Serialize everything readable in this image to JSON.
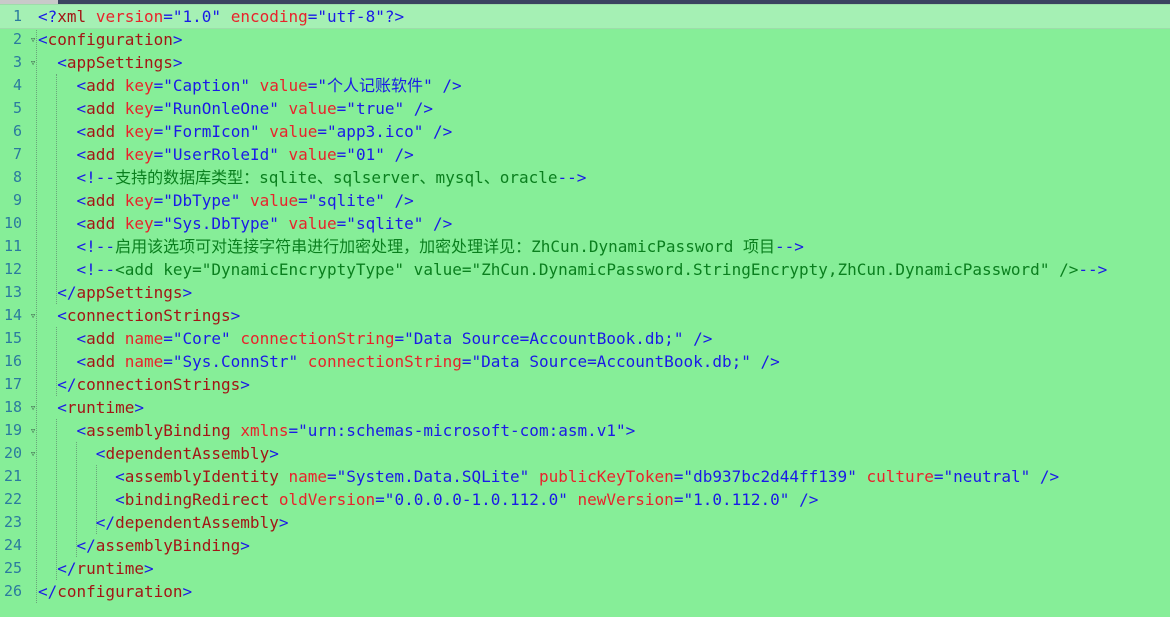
{
  "editor": {
    "language": "xml",
    "current_line": 1,
    "colors": {
      "background": "#86ee98",
      "line_number": "#2b7a9e",
      "delimiter": "#1a1ae6",
      "element": "#a31515",
      "attribute": "#e8232b",
      "attribute_value": "#1a1ae6",
      "comment": "#0a7f1e"
    },
    "lines": [
      {
        "n": "1",
        "tokens": [
          [
            "bl",
            "<?"
          ],
          [
            "br",
            "xml"
          ],
          [
            "tx",
            " "
          ],
          [
            "rd",
            "version"
          ],
          [
            "bl",
            "=\""
          ],
          [
            "vl",
            "1.0"
          ],
          [
            "bl",
            "\""
          ],
          [
            "tx",
            " "
          ],
          [
            "rd",
            "encoding"
          ],
          [
            "bl",
            "=\""
          ],
          [
            "vl",
            "utf-8"
          ],
          [
            "bl",
            "\"?>"
          ]
        ]
      },
      {
        "n": "2",
        "tokens": [
          [
            "bl",
            "<"
          ],
          [
            "br",
            "configuration"
          ],
          [
            "bl",
            ">"
          ]
        ]
      },
      {
        "n": "3",
        "tokens": [
          [
            "tx",
            "  "
          ],
          [
            "bl",
            "<"
          ],
          [
            "br",
            "appSettings"
          ],
          [
            "bl",
            ">"
          ]
        ]
      },
      {
        "n": "4",
        "tokens": [
          [
            "tx",
            "    "
          ],
          [
            "bl",
            "<"
          ],
          [
            "br",
            "add"
          ],
          [
            "tx",
            " "
          ],
          [
            "rd",
            "key"
          ],
          [
            "bl",
            "=\""
          ],
          [
            "vl",
            "Caption"
          ],
          [
            "bl",
            "\""
          ],
          [
            "tx",
            " "
          ],
          [
            "rd",
            "value"
          ],
          [
            "bl",
            "=\""
          ],
          [
            "vl",
            "个人记账软件"
          ],
          [
            "bl",
            "\""
          ],
          [
            "tx",
            " "
          ],
          [
            "bl",
            "/>"
          ]
        ]
      },
      {
        "n": "5",
        "tokens": [
          [
            "tx",
            "    "
          ],
          [
            "bl",
            "<"
          ],
          [
            "br",
            "add"
          ],
          [
            "tx",
            " "
          ],
          [
            "rd",
            "key"
          ],
          [
            "bl",
            "=\""
          ],
          [
            "vl",
            "RunOnleOne"
          ],
          [
            "bl",
            "\""
          ],
          [
            "tx",
            " "
          ],
          [
            "rd",
            "value"
          ],
          [
            "bl",
            "=\""
          ],
          [
            "vl",
            "true"
          ],
          [
            "bl",
            "\""
          ],
          [
            "tx",
            " "
          ],
          [
            "bl",
            "/>"
          ]
        ]
      },
      {
        "n": "6",
        "tokens": [
          [
            "tx",
            "    "
          ],
          [
            "bl",
            "<"
          ],
          [
            "br",
            "add"
          ],
          [
            "tx",
            " "
          ],
          [
            "rd",
            "key"
          ],
          [
            "bl",
            "=\""
          ],
          [
            "vl",
            "FormIcon"
          ],
          [
            "bl",
            "\""
          ],
          [
            "tx",
            " "
          ],
          [
            "rd",
            "value"
          ],
          [
            "bl",
            "=\""
          ],
          [
            "vl",
            "app3.ico"
          ],
          [
            "bl",
            "\""
          ],
          [
            "tx",
            " "
          ],
          [
            "bl",
            "/>"
          ]
        ]
      },
      {
        "n": "7",
        "tokens": [
          [
            "tx",
            "    "
          ],
          [
            "bl",
            "<"
          ],
          [
            "br",
            "add"
          ],
          [
            "tx",
            " "
          ],
          [
            "rd",
            "key"
          ],
          [
            "bl",
            "=\""
          ],
          [
            "vl",
            "UserRoleId"
          ],
          [
            "bl",
            "\""
          ],
          [
            "tx",
            " "
          ],
          [
            "rd",
            "value"
          ],
          [
            "bl",
            "=\""
          ],
          [
            "vl",
            "01"
          ],
          [
            "bl",
            "\""
          ],
          [
            "tx",
            " "
          ],
          [
            "bl",
            "/>"
          ]
        ]
      },
      {
        "n": "8",
        "tokens": [
          [
            "tx",
            "    "
          ],
          [
            "bl",
            "<!--"
          ],
          [
            "cm",
            "支持的数据库类型：sqlite、sqlserver、mysql、oracle"
          ],
          [
            "bl",
            "-->"
          ]
        ]
      },
      {
        "n": "9",
        "tokens": [
          [
            "tx",
            "    "
          ],
          [
            "bl",
            "<"
          ],
          [
            "br",
            "add"
          ],
          [
            "tx",
            " "
          ],
          [
            "rd",
            "key"
          ],
          [
            "bl",
            "=\""
          ],
          [
            "vl",
            "DbType"
          ],
          [
            "bl",
            "\""
          ],
          [
            "tx",
            " "
          ],
          [
            "rd",
            "value"
          ],
          [
            "bl",
            "=\""
          ],
          [
            "vl",
            "sqlite"
          ],
          [
            "bl",
            "\""
          ],
          [
            "tx",
            " "
          ],
          [
            "bl",
            "/>"
          ]
        ]
      },
      {
        "n": "10",
        "tokens": [
          [
            "tx",
            "    "
          ],
          [
            "bl",
            "<"
          ],
          [
            "br",
            "add"
          ],
          [
            "tx",
            " "
          ],
          [
            "rd",
            "key"
          ],
          [
            "bl",
            "=\""
          ],
          [
            "vl",
            "Sys.DbType"
          ],
          [
            "bl",
            "\""
          ],
          [
            "tx",
            " "
          ],
          [
            "rd",
            "value"
          ],
          [
            "bl",
            "=\""
          ],
          [
            "vl",
            "sqlite"
          ],
          [
            "bl",
            "\""
          ],
          [
            "tx",
            " "
          ],
          [
            "bl",
            "/>"
          ]
        ]
      },
      {
        "n": "11",
        "tokens": [
          [
            "tx",
            "    "
          ],
          [
            "bl",
            "<!--"
          ],
          [
            "cm",
            "启用该选项可对连接字符串进行加密处理，加密处理详见：ZhCun.DynamicPassword 项目"
          ],
          [
            "bl",
            "-->"
          ]
        ]
      },
      {
        "n": "12",
        "tokens": [
          [
            "tx",
            "    "
          ],
          [
            "bl",
            "<!--"
          ],
          [
            "cm",
            "<add key=\"DynamicEncryptyType\" value=\"ZhCun.DynamicPassword.StringEncrypty,ZhCun.DynamicPassword\" />"
          ],
          [
            "bl",
            "-->"
          ]
        ]
      },
      {
        "n": "13",
        "tokens": [
          [
            "tx",
            "  "
          ],
          [
            "bl",
            "</"
          ],
          [
            "br",
            "appSettings"
          ],
          [
            "bl",
            ">"
          ]
        ]
      },
      {
        "n": "14",
        "tokens": [
          [
            "tx",
            "  "
          ],
          [
            "bl",
            "<"
          ],
          [
            "br",
            "connectionStrings"
          ],
          [
            "bl",
            ">"
          ]
        ]
      },
      {
        "n": "15",
        "tokens": [
          [
            "tx",
            "    "
          ],
          [
            "bl",
            "<"
          ],
          [
            "br",
            "add"
          ],
          [
            "tx",
            " "
          ],
          [
            "rd",
            "name"
          ],
          [
            "bl",
            "=\""
          ],
          [
            "vl",
            "Core"
          ],
          [
            "bl",
            "\""
          ],
          [
            "tx",
            " "
          ],
          [
            "rd",
            "connectionString"
          ],
          [
            "bl",
            "=\""
          ],
          [
            "vl",
            "Data Source=AccountBook.db;"
          ],
          [
            "bl",
            "\""
          ],
          [
            "tx",
            " "
          ],
          [
            "bl",
            "/>"
          ]
        ]
      },
      {
        "n": "16",
        "tokens": [
          [
            "tx",
            "    "
          ],
          [
            "bl",
            "<"
          ],
          [
            "br",
            "add"
          ],
          [
            "tx",
            " "
          ],
          [
            "rd",
            "name"
          ],
          [
            "bl",
            "=\""
          ],
          [
            "vl",
            "Sys.ConnStr"
          ],
          [
            "bl",
            "\""
          ],
          [
            "tx",
            " "
          ],
          [
            "rd",
            "connectionString"
          ],
          [
            "bl",
            "=\""
          ],
          [
            "vl",
            "Data Source=AccountBook.db;"
          ],
          [
            "bl",
            "\""
          ],
          [
            "tx",
            " "
          ],
          [
            "bl",
            "/>"
          ]
        ]
      },
      {
        "n": "17",
        "tokens": [
          [
            "tx",
            "  "
          ],
          [
            "bl",
            "</"
          ],
          [
            "br",
            "connectionStrings"
          ],
          [
            "bl",
            ">"
          ]
        ]
      },
      {
        "n": "18",
        "tokens": [
          [
            "tx",
            "  "
          ],
          [
            "bl",
            "<"
          ],
          [
            "br",
            "runtime"
          ],
          [
            "bl",
            ">"
          ]
        ]
      },
      {
        "n": "19",
        "tokens": [
          [
            "tx",
            "    "
          ],
          [
            "bl",
            "<"
          ],
          [
            "br",
            "assemblyBinding"
          ],
          [
            "tx",
            " "
          ],
          [
            "rd",
            "xmlns"
          ],
          [
            "bl",
            "=\""
          ],
          [
            "vl",
            "urn:schemas-microsoft-com:asm.v1"
          ],
          [
            "bl",
            "\">"
          ]
        ]
      },
      {
        "n": "20",
        "tokens": [
          [
            "tx",
            "      "
          ],
          [
            "bl",
            "<"
          ],
          [
            "br",
            "dependentAssembly"
          ],
          [
            "bl",
            ">"
          ]
        ]
      },
      {
        "n": "21",
        "tokens": [
          [
            "tx",
            "        "
          ],
          [
            "bl",
            "<"
          ],
          [
            "br",
            "assemblyIdentity"
          ],
          [
            "tx",
            " "
          ],
          [
            "rd",
            "name"
          ],
          [
            "bl",
            "=\""
          ],
          [
            "vl",
            "System.Data.SQLite"
          ],
          [
            "bl",
            "\""
          ],
          [
            "tx",
            " "
          ],
          [
            "rd",
            "publicKeyToken"
          ],
          [
            "bl",
            "=\""
          ],
          [
            "vl",
            "db937bc2d44ff139"
          ],
          [
            "bl",
            "\""
          ],
          [
            "tx",
            " "
          ],
          [
            "rd",
            "culture"
          ],
          [
            "bl",
            "=\""
          ],
          [
            "vl",
            "neutral"
          ],
          [
            "bl",
            "\""
          ],
          [
            "tx",
            " "
          ],
          [
            "bl",
            "/>"
          ]
        ]
      },
      {
        "n": "22",
        "tokens": [
          [
            "tx",
            "        "
          ],
          [
            "bl",
            "<"
          ],
          [
            "br",
            "bindingRedirect"
          ],
          [
            "tx",
            " "
          ],
          [
            "rd",
            "oldVersion"
          ],
          [
            "bl",
            "=\""
          ],
          [
            "vl",
            "0.0.0.0-1.0.112.0"
          ],
          [
            "bl",
            "\""
          ],
          [
            "tx",
            " "
          ],
          [
            "rd",
            "newVersion"
          ],
          [
            "bl",
            "=\""
          ],
          [
            "vl",
            "1.0.112.0"
          ],
          [
            "bl",
            "\""
          ],
          [
            "tx",
            " "
          ],
          [
            "bl",
            "/>"
          ]
        ]
      },
      {
        "n": "23",
        "tokens": [
          [
            "tx",
            "      "
          ],
          [
            "bl",
            "</"
          ],
          [
            "br",
            "dependentAssembly"
          ],
          [
            "bl",
            ">"
          ]
        ]
      },
      {
        "n": "24",
        "tokens": [
          [
            "tx",
            "    "
          ],
          [
            "bl",
            "</"
          ],
          [
            "br",
            "assemblyBinding"
          ],
          [
            "bl",
            ">"
          ]
        ]
      },
      {
        "n": "25",
        "tokens": [
          [
            "tx",
            "  "
          ],
          [
            "bl",
            "</"
          ],
          [
            "br",
            "runtime"
          ],
          [
            "bl",
            ">"
          ]
        ]
      },
      {
        "n": "26",
        "tokens": [
          [
            "bl",
            "</"
          ],
          [
            "br",
            "configuration"
          ],
          [
            "bl",
            ">"
          ]
        ]
      }
    ],
    "fold_lines": [
      "2",
      "3",
      "14",
      "18",
      "19",
      "20"
    ]
  }
}
